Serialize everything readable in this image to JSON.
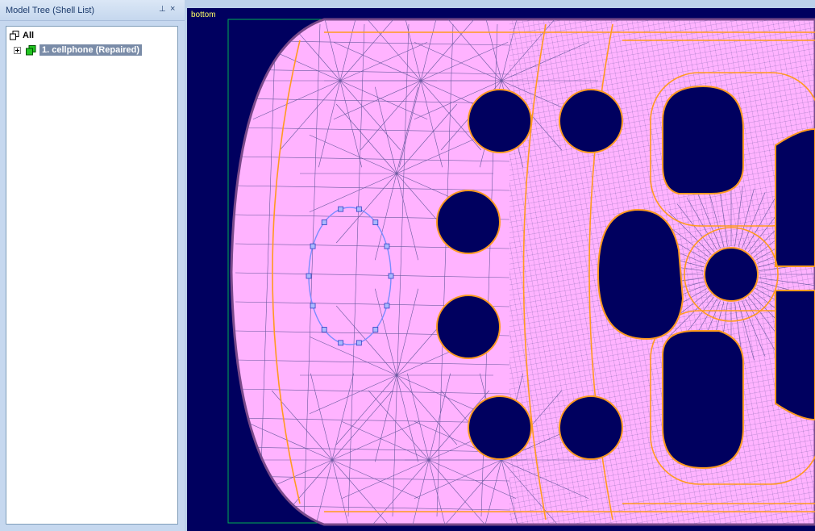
{
  "panel": {
    "title": "Model Tree (Shell List)",
    "pin_glyph": "⊥",
    "close_glyph": "×",
    "icons": {
      "pin": "pin-icon",
      "close": "close-icon",
      "all": "tree-all-icon",
      "shell": "shell-icon"
    }
  },
  "tree": {
    "root_label": "All",
    "items": [
      {
        "label": "1. cellphone (Repaired)",
        "selected": true
      }
    ]
  },
  "viewport": {
    "view_name": "bottom"
  },
  "colors": {
    "viewport_bg": "#00005f",
    "mesh_fill": "#ffb3ff",
    "mesh_edge": "#6a5aa0",
    "feature_edge": "#ff9a1f",
    "selection": "#7a8cff",
    "bbox": "#00b050",
    "label": "#ffff66",
    "selection_bg": "#7a8ca8"
  }
}
